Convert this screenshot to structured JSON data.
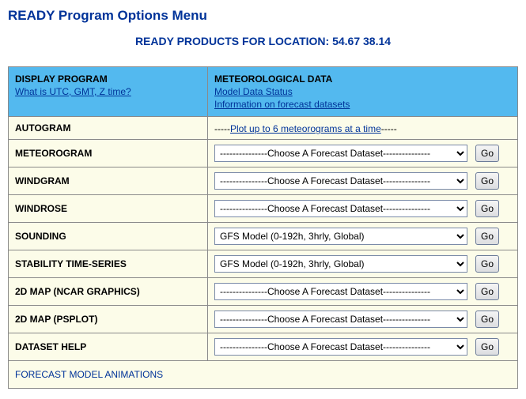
{
  "page": {
    "title": "READY Program Options Menu",
    "subtitle": "READY PRODUCTS FOR LOCATION: 54.67 38.14"
  },
  "header": {
    "left_label": "DISPLAY PROGRAM",
    "left_link": "What is UTC, GMT, Z time?",
    "right_label": "METEOROLOGICAL DATA",
    "right_link1": "Model Data Status",
    "right_link2": "Information on forecast datasets"
  },
  "autogram": {
    "label": "AUTOGRAM",
    "prefix": "-----",
    "link": "Plot up to 6 meteorograms at a time",
    "suffix": "-----"
  },
  "options": {
    "choose": "---------------Choose A Forecast Dataset---------------",
    "gfs": "GFS Model (0-192h, 3hrly, Global)"
  },
  "rows": [
    {
      "label": "METEOROGRAM",
      "selected": "---------------Choose A Forecast Dataset---------------"
    },
    {
      "label": "WINDGRAM",
      "selected": "---------------Choose A Forecast Dataset---------------"
    },
    {
      "label": "WINDROSE",
      "selected": "---------------Choose A Forecast Dataset---------------"
    },
    {
      "label": "SOUNDING",
      "selected": "GFS Model (0-192h, 3hrly, Global)"
    },
    {
      "label": "STABILITY TIME-SERIES",
      "selected": "GFS Model (0-192h, 3hrly, Global)"
    },
    {
      "label": "2D MAP (NCAR GRAPHICS)",
      "selected": "---------------Choose A Forecast Dataset---------------"
    },
    {
      "label": "2D MAP (PSPLOT)",
      "selected": "---------------Choose A Forecast Dataset---------------"
    },
    {
      "label": "DATASET HELP",
      "selected": "---------------Choose A Forecast Dataset---------------"
    }
  ],
  "go_label": "Go",
  "footer": {
    "label": "FORECAST MODEL ANIMATIONS"
  }
}
